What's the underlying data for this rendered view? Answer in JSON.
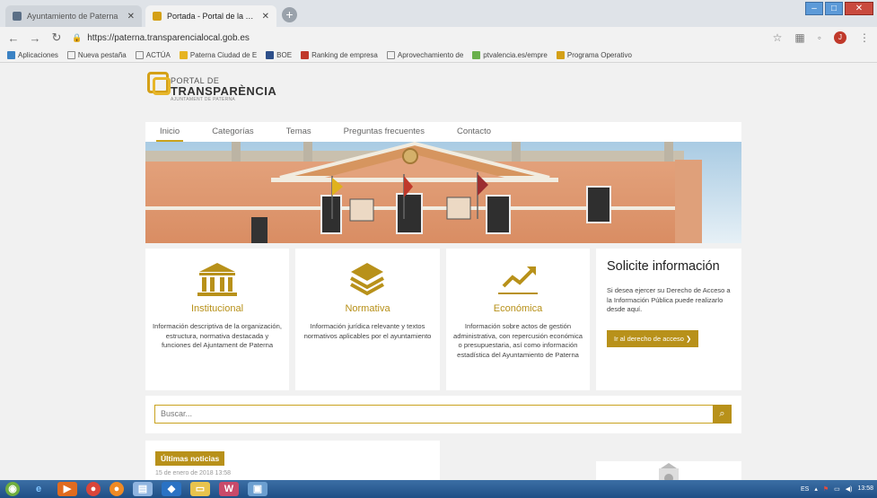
{
  "browser": {
    "tabs": [
      {
        "title": "Ayuntamiento de Paterna",
        "active": false
      },
      {
        "title": "Portada - Portal de la Transparen",
        "active": true
      }
    ],
    "url": "https://paterna.transparencialocal.gob.es",
    "bookmarks": [
      "Aplicaciones",
      "Nueva pestaña",
      "ACTÚA",
      "Paterna Ciudad de E",
      "BOE",
      "Ranking de empresa",
      "Aprovechamiento de",
      "ptvalencia.es/empre",
      "Programa Operativo"
    ]
  },
  "logo": {
    "line1": "PORTAL DE",
    "line2": "TRANSPARÈNCIA",
    "line3": "AJUNTAMENT DE PATERNA"
  },
  "nav": [
    "Inicio",
    "Categorías",
    "Temas",
    "Preguntas frecuentes",
    "Contacto"
  ],
  "cards": [
    {
      "title": "Institucional",
      "icon": "building-columns-icon",
      "text": "Información descriptiva de la organización, estructura, normativa destacada y funciones del Ajuntament de Paterna"
    },
    {
      "title": "Normativa",
      "icon": "layers-icon",
      "text": "Información jurídica relevante y textos normativos aplicables por el ayuntamiento"
    },
    {
      "title": "Económica",
      "icon": "trend-up-icon",
      "text": "Información sobre actos de gestión administrativa, con repercusión económica o presupuestaria, así como información estadística del Ayuntamiento de Paterna"
    }
  ],
  "info": {
    "title": "Solicite información",
    "text": "Si desea ejercer su Derecho de Acceso a la Información Pública puede realizarlo desde aquí.",
    "button": "Ir al derecho de acceso ❯"
  },
  "search": {
    "placeholder": "Buscar..."
  },
  "news": {
    "badge": "Últimas noticias",
    "date": "15 de enero de 2018 13:58"
  },
  "taskbar": {
    "lang": "ES",
    "time": "13:58"
  },
  "colors": {
    "accent": "#b8911a",
    "page_bg": "#f1f1f1"
  }
}
